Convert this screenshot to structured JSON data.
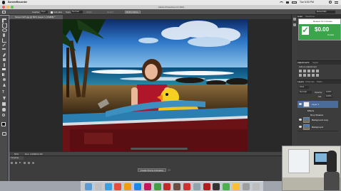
{
  "menubar": {
    "app": "ScreenRecorder",
    "clock": "Tue 6:00 PM",
    "icons": [
      "apple-icon",
      "wifi-icon",
      "volume-icon",
      "battery-icon",
      "search-icon",
      "list-icon"
    ]
  },
  "window": {
    "title": "Adobe Photoshop CC 2014"
  },
  "options_bar": {
    "feather_label": "Feather:",
    "feather_value": "0 px",
    "anti_alias_label": "Anti-alias",
    "style_label": "Style:",
    "style_value": "Normal",
    "width_label": "Width:",
    "height_label": "Height:",
    "refine_edge_label": "Refine Edge...",
    "workspace": "Essentials"
  },
  "document": {
    "tab_title": "Screen 627.jpg @ 50% (Layer 1, RGB/8) *",
    "status_zoom": "50%",
    "status_doc": "Doc: 4.00M/12.1M"
  },
  "ad_popup": {
    "title": "Reason for increase",
    "price": "$0.00",
    "details_label": "Details"
  },
  "panels": {
    "color_tab": "Color",
    "swatches_tab": "Swatches",
    "adjustments_tab": "Adjustments",
    "styles_tab": "Styles",
    "add_adjustment_label": "Add an adjustment",
    "layers_tab": "Layers",
    "channels_tab": "Channels",
    "paths_tab": "Paths",
    "kind_label": "Kind",
    "normal_label": "Normal",
    "opacity_label": "Opacity:",
    "opacity_value": "100%",
    "fill_label": "Fill:",
    "fill_value": "100%",
    "layers": [
      {
        "name": "Layer 1",
        "selected": true
      },
      {
        "name": "Effects",
        "selected": false
      },
      {
        "name": "Drop Shadow",
        "selected": false
      },
      {
        "name": "Background copy",
        "selected": false
      },
      {
        "name": "Background",
        "selected": false
      }
    ]
  },
  "timeline": {
    "tab": "Timeline",
    "create_button": "Create Frame Animation"
  },
  "dock": {
    "apps": [
      "finder-icon",
      "launchpad-icon",
      "safari-icon",
      "chrome-icon",
      "illustrator-icon",
      "photoshop-icon",
      "indesign-icon",
      "dreamweaver-icon",
      "flash-icon",
      "bridge-icon",
      "acrobat-icon",
      "preview-icon",
      "filezilla-icon",
      "terminal-icon",
      "facetime-icon",
      "notes-icon",
      "settings-icon",
      "trash-icon"
    ],
    "colors": [
      "#5b9bd5",
      "#c0c0c0",
      "#3aa0e0",
      "#e74c3c",
      "#f39c12",
      "#1e88e5",
      "#c2185b",
      "#43a047",
      "#c62828",
      "#6d4c41",
      "#d32f2f",
      "#90a4ae",
      "#b71c1c",
      "#333333",
      "#4caf50",
      "#fbc02d",
      "#9e9e9e",
      "#bdbdbd"
    ]
  }
}
